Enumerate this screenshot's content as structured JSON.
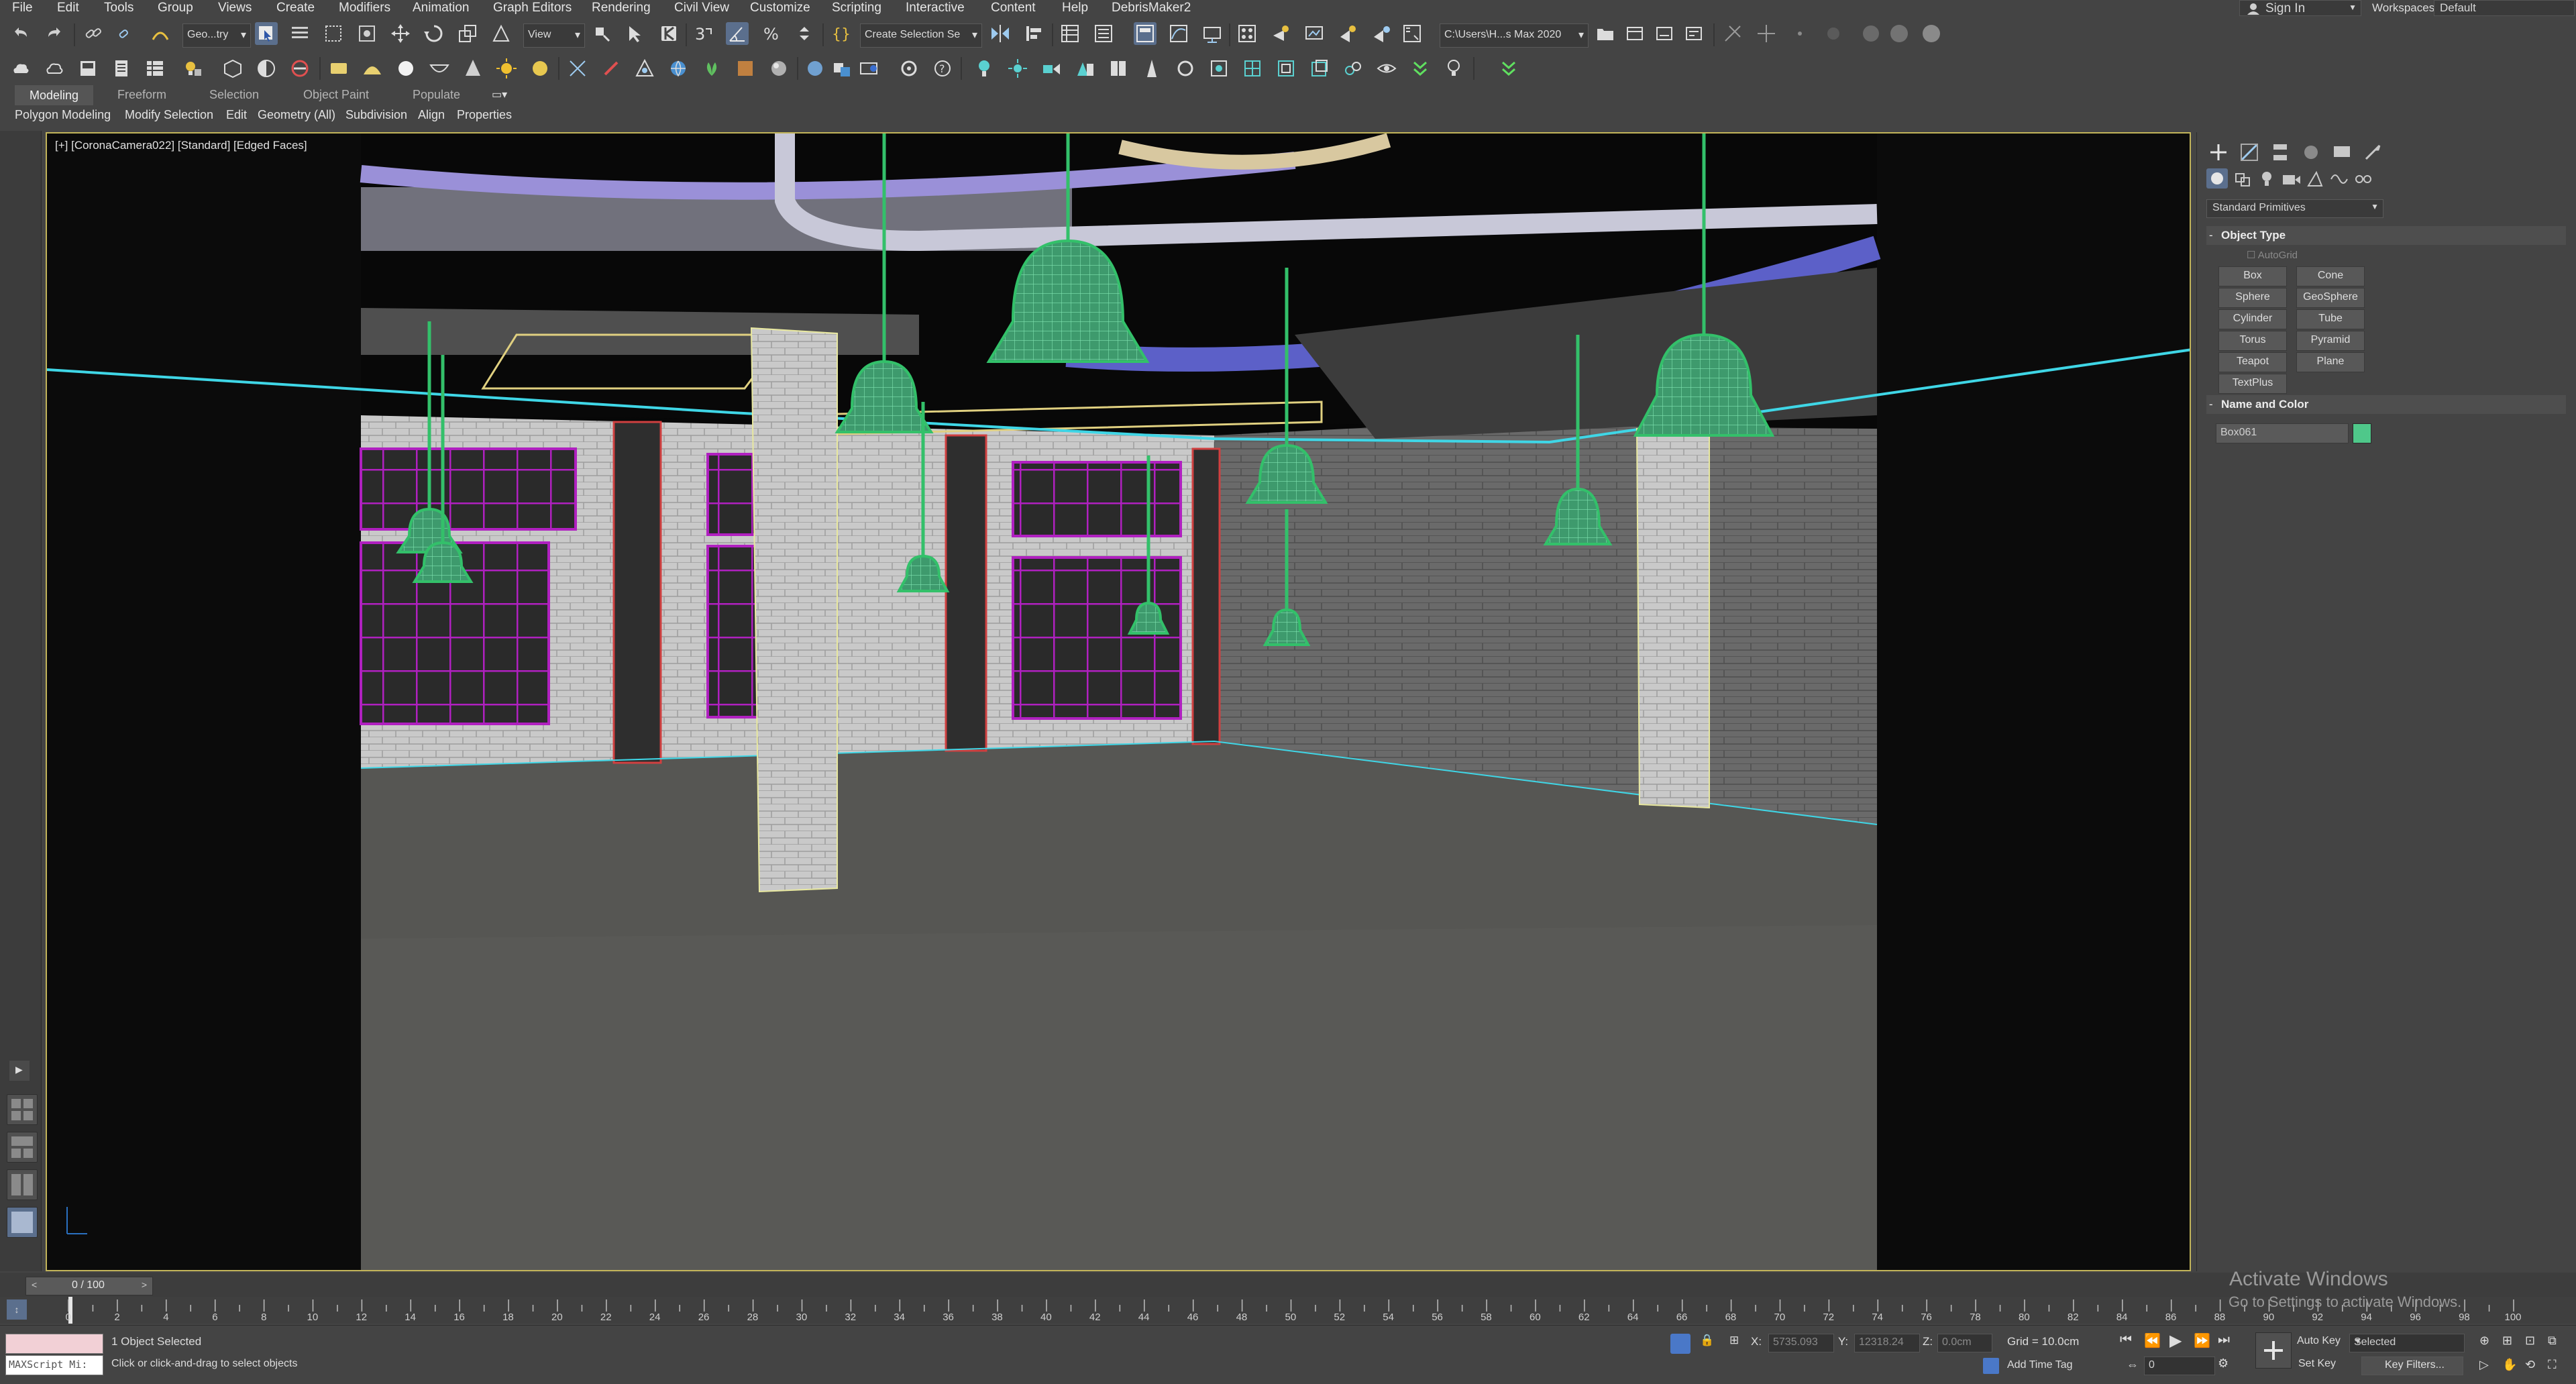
{
  "menu": [
    "File",
    "Edit",
    "Tools",
    "Group",
    "Views",
    "Create",
    "Modifiers",
    "Animation",
    "Graph Editors",
    "Rendering",
    "Civil View",
    "Customize",
    "Scripting",
    "Interactive",
    "Content",
    "Help",
    "DebrisMaker2"
  ],
  "account": {
    "sign_in": "Sign In",
    "workspaces_label": "Workspaces:",
    "workspace": "Default"
  },
  "toolbar": {
    "selection_filter": "Geo...try",
    "ref_coord": "View",
    "selection_set": "Create Selection Se",
    "project_path": "C:\\Users\\H...s Max 2020"
  },
  "ribbon": {
    "tabs": [
      "Modeling",
      "Freeform",
      "Selection",
      "Object Paint",
      "Populate"
    ],
    "panels": [
      "Polygon Modeling",
      "Modify Selection",
      "Edit",
      "Geometry (All)",
      "Subdivision",
      "Align",
      "Properties"
    ]
  },
  "viewport": {
    "label": "[+] [CoronaCamera022] [Standard] [Edged Faces]"
  },
  "command_panel": {
    "category": "Standard Primitives",
    "object_type_title": "Object Type",
    "autogrid": "AutoGrid",
    "primitives": [
      "Box",
      "Cone",
      "Sphere",
      "GeoSphere",
      "Cylinder",
      "Tube",
      "Torus",
      "Pyramid",
      "Teapot",
      "Plane",
      "TextPlus"
    ],
    "name_color_title": "Name and Color",
    "object_name": "Box061",
    "object_color": "#4fc88a"
  },
  "timeline": {
    "frame_display": "0 / 100",
    "ticks": [
      "0",
      "2",
      "4",
      "6",
      "8",
      "10",
      "12",
      "14",
      "16",
      "18",
      "20",
      "22",
      "24",
      "26",
      "28",
      "30",
      "32",
      "34",
      "36",
      "38",
      "40",
      "42",
      "44",
      "46",
      "48",
      "50",
      "52",
      "54",
      "56",
      "58",
      "60",
      "62",
      "64",
      "66",
      "68",
      "70",
      "72",
      "74",
      "76",
      "78",
      "80",
      "82",
      "84",
      "86",
      "88",
      "90",
      "92",
      "94",
      "96",
      "98",
      "100"
    ]
  },
  "status": {
    "maxscript": "MAXScript Mi:",
    "selected": "1 Object Selected",
    "prompt": "Click or click-and-drag to select objects",
    "x_label": "X:",
    "x_value": "5735.093",
    "y_label": "Y:",
    "y_value": "12318.24",
    "z_label": "Z:",
    "z_value": "0.0cm",
    "grid": "Grid = 10.0cm",
    "add_time_tag": "Add Time Tag",
    "auto_key": "Auto Key",
    "set_key": "Set Key",
    "key_mode": "Selected",
    "key_filters": "Key Filters...",
    "current_frame": "0"
  },
  "watermark": {
    "title": "Activate Windows",
    "subtitle": "Go to Settings to activate Windows."
  },
  "colors": {
    "accent": "#5b6f8d",
    "viewport_border": "#c2b45a",
    "lamp": "#4fc88a",
    "window_frame": "#b020c0",
    "wire_cyan": "#3fd6e6"
  }
}
